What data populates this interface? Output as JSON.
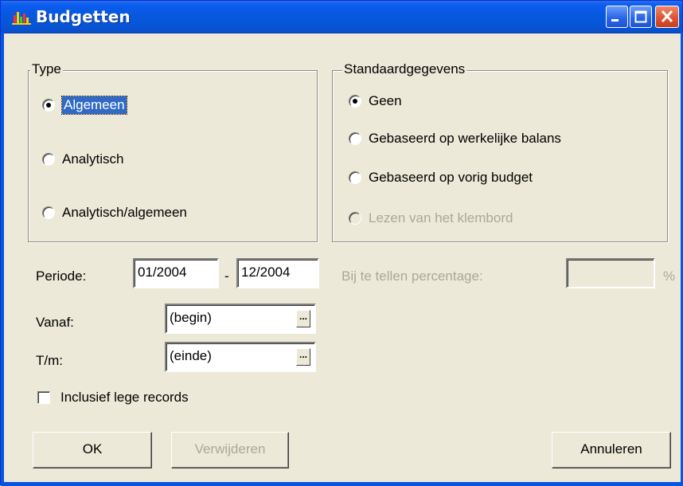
{
  "window": {
    "title": "Budgetten",
    "icon": "bar-chart-icon"
  },
  "titlebar_buttons": {
    "minimize": "minimize-icon",
    "maximize": "maximize-icon",
    "close": "close-icon"
  },
  "type_group": {
    "legend": "Type",
    "options": [
      {
        "label": "Algemeen",
        "checked": true
      },
      {
        "label": "Analytisch",
        "checked": false
      },
      {
        "label": "Analytisch/algemeen",
        "checked": false
      }
    ]
  },
  "standard_group": {
    "legend": "Standaardgegevens",
    "options": [
      {
        "label": "Geen",
        "checked": true,
        "enabled": true
      },
      {
        "label": "Gebaseerd op werkelijke balans",
        "checked": false,
        "enabled": true
      },
      {
        "label": "Gebaseerd op vorig budget",
        "checked": false,
        "enabled": true
      },
      {
        "label": "Lezen van het klembord",
        "checked": false,
        "enabled": false
      }
    ]
  },
  "period": {
    "label": "Periode:",
    "from": "01/2004",
    "separator": "-",
    "to": "12/2004"
  },
  "percentage": {
    "label": "Bij te tellen percentage:",
    "value": "",
    "unit": "%"
  },
  "vanaf": {
    "label": "Vanaf:",
    "value": "(begin)",
    "button": "..."
  },
  "tm": {
    "label": "T/m:",
    "value": "(einde)",
    "button": "..."
  },
  "include_empty": {
    "label": "Inclusief lege records",
    "checked": false
  },
  "buttons": {
    "ok": "OK",
    "delete": "Verwijderen",
    "cancel": "Annuleren"
  },
  "colors": {
    "titlebar": "#0a5ef2",
    "face": "#ece9d8",
    "selection": "#316ac5",
    "disabled_text": "#aca899"
  }
}
